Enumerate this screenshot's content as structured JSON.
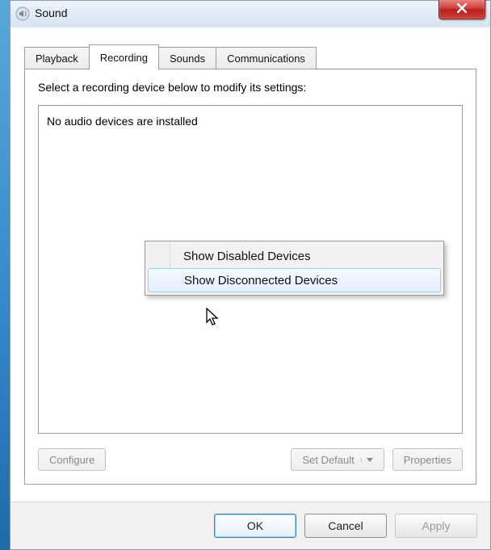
{
  "window": {
    "title": "Sound"
  },
  "tabs": {
    "playback": "Playback",
    "recording": "Recording",
    "sounds": "Sounds",
    "communications": "Communications",
    "active": "recording"
  },
  "instruction": "Select a recording device below to modify its settings:",
  "device_list": {
    "empty_message": "No audio devices are installed"
  },
  "lower": {
    "configure": "Configure",
    "set_default": "Set Default",
    "properties": "Properties"
  },
  "footer": {
    "ok": "OK",
    "cancel": "Cancel",
    "apply": "Apply"
  },
  "context_menu": {
    "items": [
      "Show Disabled Devices",
      "Show Disconnected Devices"
    ],
    "hover_index": 1
  }
}
